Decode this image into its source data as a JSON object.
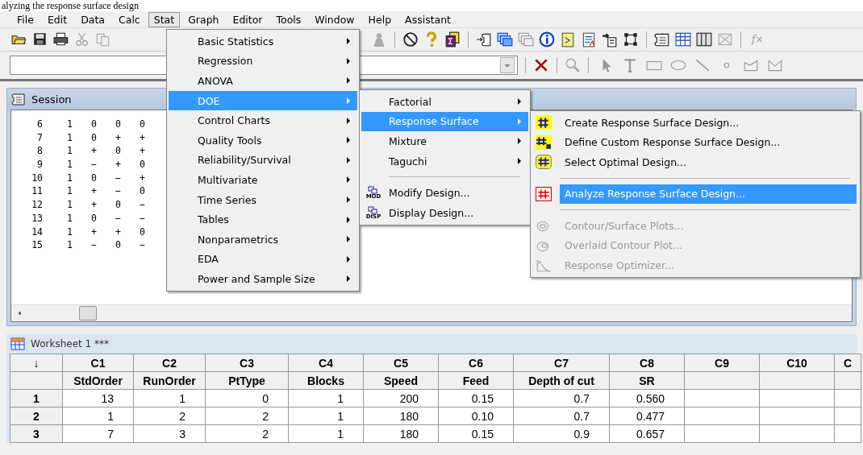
{
  "caption": "alyzing the response surface design",
  "menu_bar": [
    {
      "label": "File",
      "selected": false
    },
    {
      "label": "Edit",
      "selected": false
    },
    {
      "label": "Data",
      "selected": false
    },
    {
      "label": "Calc",
      "selected": false
    },
    {
      "label": "Stat",
      "selected": true
    },
    {
      "label": "Graph",
      "selected": false
    },
    {
      "label": "Editor",
      "selected": false
    },
    {
      "label": "Tools",
      "selected": false
    },
    {
      "label": "Window",
      "selected": false
    },
    {
      "label": "Help",
      "selected": false
    },
    {
      "label": "Assistant",
      "selected": false
    }
  ],
  "formula_button": "f×",
  "stat_menu": [
    {
      "label": "Basic Statistics",
      "selected": false
    },
    {
      "label": "Regression",
      "selected": false
    },
    {
      "label": "ANOVA",
      "selected": false
    },
    {
      "label": "DOE",
      "selected": true
    },
    {
      "label": "Control Charts",
      "selected": false
    },
    {
      "label": "Quality Tools",
      "selected": false
    },
    {
      "label": "Reliability/Survival",
      "selected": false
    },
    {
      "label": "Multivariate",
      "selected": false
    },
    {
      "label": "Time Series",
      "selected": false
    },
    {
      "label": "Tables",
      "selected": false
    },
    {
      "label": "Nonparametrics",
      "selected": false
    },
    {
      "label": "EDA",
      "selected": false
    },
    {
      "label": "Power and Sample Size",
      "selected": false
    }
  ],
  "doe_menu": [
    {
      "kind": "submenu",
      "label": "Factorial",
      "selected": false
    },
    {
      "kind": "submenu",
      "label": "Response Surface",
      "selected": true
    },
    {
      "kind": "submenu",
      "label": "Mixture",
      "selected": false
    },
    {
      "kind": "submenu",
      "label": "Taguchi",
      "selected": false
    },
    {
      "kind": "separator"
    },
    {
      "kind": "command",
      "label": "Modify Design...",
      "icon_caption": "MOD",
      "selected": false
    },
    {
      "kind": "command",
      "label": "Display Design...",
      "icon_caption": "DISP",
      "selected": false
    }
  ],
  "response_surface_menu": [
    {
      "kind": "command",
      "label": "Create Response Surface Design...",
      "selected": false,
      "disabled": false
    },
    {
      "kind": "command",
      "label": "Define Custom Response Surface Design...",
      "selected": false,
      "disabled": false
    },
    {
      "kind": "command",
      "label": "Select Optimal Design...",
      "selected": false,
      "disabled": false
    },
    {
      "kind": "separator"
    },
    {
      "kind": "command",
      "label": "Analyze Response Surface Design...",
      "selected": true,
      "disabled": false
    },
    {
      "kind": "separator"
    },
    {
      "kind": "command",
      "label": "Contour/Surface Plots...",
      "selected": false,
      "disabled": true
    },
    {
      "kind": "command",
      "label": "Overlaid Contour Plot...",
      "selected": false,
      "disabled": true
    },
    {
      "kind": "command",
      "label": "Response Optimizer...",
      "selected": false,
      "disabled": true
    }
  ],
  "session": {
    "title": "Session",
    "rows": [
      [
        "6",
        "1",
        "0",
        "0",
        "0"
      ],
      [
        "7",
        "1",
        "0",
        "+",
        "+"
      ],
      [
        "8",
        "1",
        "+",
        "0",
        "+"
      ],
      [
        "9",
        "1",
        "−",
        "+",
        "0"
      ],
      [
        "10",
        "1",
        "0",
        "−",
        "+"
      ],
      [
        "11",
        "1",
        "+",
        "−",
        "0"
      ],
      [
        "12",
        "1",
        "+",
        "0",
        "−"
      ],
      [
        "13",
        "1",
        "0",
        "−",
        "−"
      ],
      [
        "14",
        "1",
        "+",
        "+",
        "0"
      ],
      [
        "15",
        "1",
        "−",
        "0",
        "−"
      ]
    ]
  },
  "worksheet": {
    "title": "Worksheet 1 ***",
    "corner": "↓",
    "columns": [
      {
        "id": "C1",
        "name": "StdOrder"
      },
      {
        "id": "C2",
        "name": "RunOrder"
      },
      {
        "id": "C3",
        "name": "PtType"
      },
      {
        "id": "C4",
        "name": "Blocks"
      },
      {
        "id": "C5",
        "name": "Speed"
      },
      {
        "id": "C6",
        "name": "Feed"
      },
      {
        "id": "C7",
        "name": "Depth of cut"
      },
      {
        "id": "C8",
        "name": "SR"
      },
      {
        "id": "C9"
      },
      {
        "id": "C10"
      },
      {
        "id": "C"
      }
    ],
    "rows": [
      {
        "label": "1",
        "cells": [
          "13",
          "1",
          "0",
          "1",
          "200",
          "0.15",
          "0.7",
          "0.560"
        ]
      },
      {
        "label": "2",
        "cells": [
          "1",
          "2",
          "2",
          "1",
          "180",
          "0.10",
          "0.7",
          "0.477"
        ]
      },
      {
        "label": "3",
        "cells": [
          "7",
          "3",
          "2",
          "1",
          "180",
          "0.15",
          "0.9",
          "0.657"
        ]
      }
    ]
  }
}
